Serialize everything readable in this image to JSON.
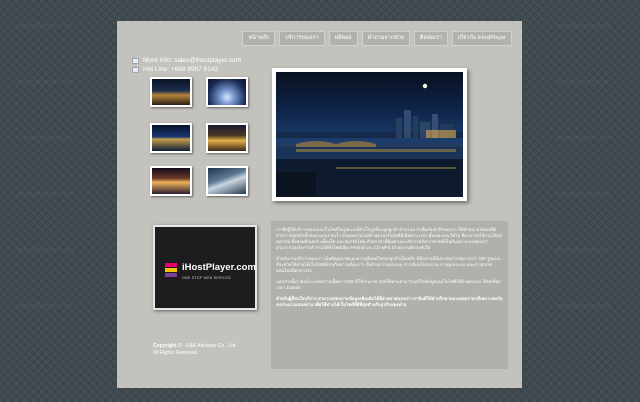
{
  "site": {
    "nav": [
      {
        "label": "หน้าหลัก"
      },
      {
        "label": "บริการของเรา"
      },
      {
        "label": "ผลิตผล"
      },
      {
        "label": "คำถามจากช่วย"
      },
      {
        "label": "ติดต่อเรา"
      },
      {
        "label": "เกี่ยวกับ iHostPlayer"
      }
    ],
    "contact": {
      "info": "More Info: sales@ihostplayer.com",
      "hotline": "Hot Line: +668 9987 6143"
    },
    "logo": {
      "name": "iHostPlayer.com",
      "tagline": "ONE STOP WEB SERVICE"
    },
    "copyright": {
      "prefix": "Copyright ©",
      "suffix": "- E&K Advisory Co., Ltd.",
      "rights": "All Rights Reserved."
    },
    "body": {
      "p1": "เราคือผู้ให้บริการออกแบบเว็บไซต์ในรูปแบบที่สำเร็จรูปที่จะดูดลูกค้าจำนวนมากเพื่อเริ่มธุรกิจของการให้จำหน่ายโดยเหลือจากการต่อหน้าทั้งหมด แบบรวดเร็ว ด้วยเทคโนโลยีล่าสุดรองรับมัลติมีเดียครบวงจร ทั้งเพลงและวิดีโอ ที่สามารถใช้งานได้ทุกอุปกรณ์ ทั้งคอมพิวเตอร์ แท็บเล็ต และสมาร์ทโฟน ด้วยราคาที่คุ้มค่าและบริการหลังการขายที่เป็นกันเอง ระบบของเราสามารถรองรับการทำงานได้ทั้งไฟล์เสียง Hi-End และ CD MP3 10 ผลงานที่ประทับใจ",
      "p2": "สำหรับงานบริการของเรา เน้นที่คุณภาพและความพึงพอใจของลูกค้าเป็นหลัก มีทีมงานที่มีประสบการณ์มากกว่า 150 รูปแบบ ที่จะช่วยให้ท่านได้เว็บไซต์ที่ตรงกับความต้องการ ทั้งด้านการออกแบบ การเขียนโปรแกรม การดูแลระบบ และการตลาดออนไลน์ที่ครบวงจร",
      "p3": "นอกจากนี้เรายังมีระบบจัดการเนื้อหา CMS ที่ใช้งานง่าย ช่วยให้ท่านสามารถแก้ไขข้อมูลบนเว็บไซต์ได้ด้วยตนเอง ได้ทุกที่ทุกเวลา Joomla",
      "p4": "สำหรับผู้ที่สนใจบริการ สามารถสอบถามข้อมูลเพิ่มเติมได้ที่ฝ่ายขายของเรา เรายินดีให้คำปรึกษาและเสนอราคาที่เหมาะสมกับงบประมาณของท่าน เพื่อให้ท่านได้เว็บไซต์ที่ดีที่สุดสำหรับธุรกิจของท่าน"
    },
    "watermark": "iHostPlayer.com"
  }
}
